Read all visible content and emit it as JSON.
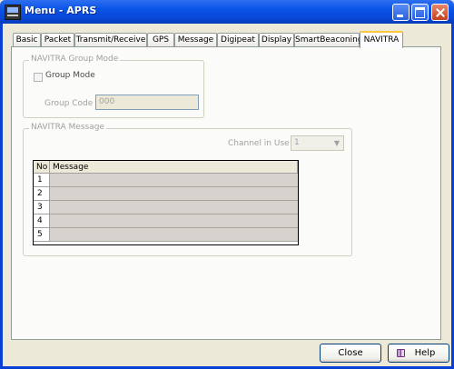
{
  "window": {
    "title": "Menu - APRS"
  },
  "tabs": [
    {
      "label": "Basic"
    },
    {
      "label": "Packet"
    },
    {
      "label": "Transmit/Receive"
    },
    {
      "label": "GPS"
    },
    {
      "label": "Message"
    },
    {
      "label": "Digipeat"
    },
    {
      "label": "Display"
    },
    {
      "label": "SmartBeaconing"
    },
    {
      "label": "NAVITRA",
      "active": true
    }
  ],
  "group_mode": {
    "legend": "NAVITRA Group Mode",
    "checkbox_label": "Group Mode",
    "checked": false,
    "group_code_label": "Group Code",
    "group_code_value": "000"
  },
  "message": {
    "legend": "NAVITRA Message",
    "channel_label": "Channel in Use",
    "channel_value": "1",
    "table": {
      "columns": [
        "No",
        "Message"
      ],
      "rows": [
        {
          "no": "1",
          "message": ""
        },
        {
          "no": "2",
          "message": ""
        },
        {
          "no": "3",
          "message": ""
        },
        {
          "no": "4",
          "message": ""
        },
        {
          "no": "5",
          "message": ""
        }
      ]
    }
  },
  "buttons": {
    "close_label": "Close",
    "help_label": "Help"
  },
  "colors": {
    "titlebar": "#0A53E6",
    "active_tab_accent": "#FFC83C",
    "button_border": "#003C74"
  }
}
